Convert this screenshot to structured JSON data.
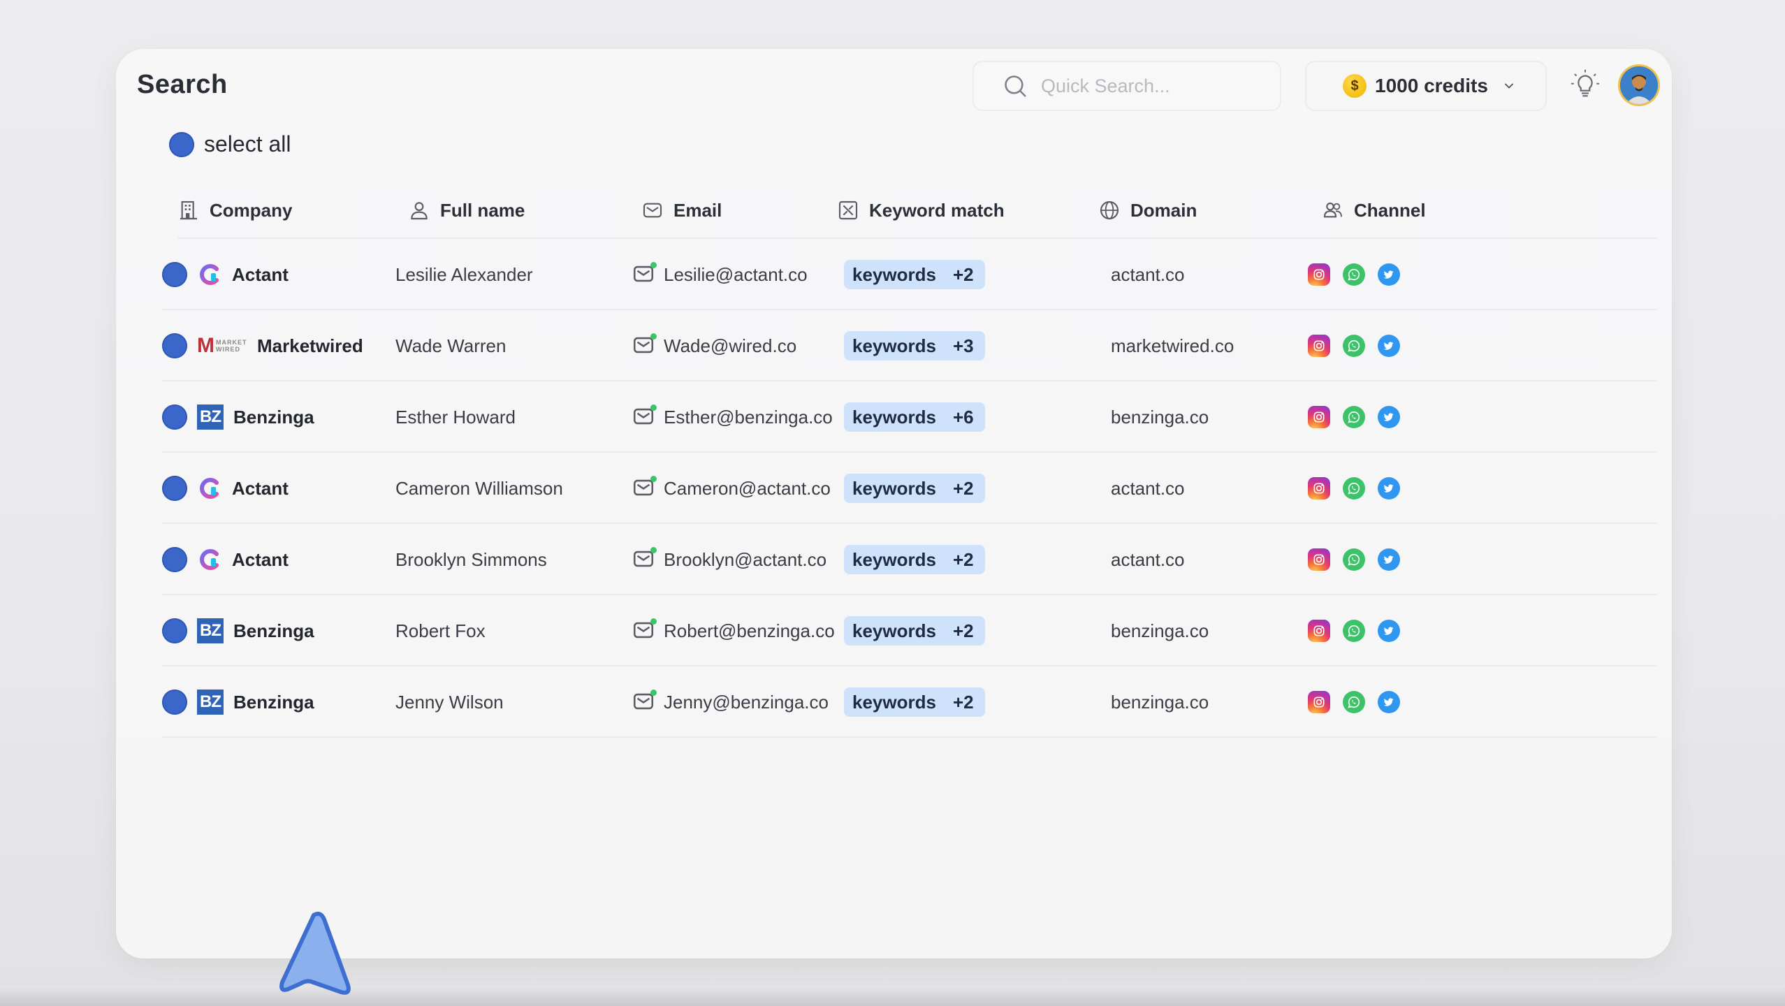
{
  "header": {
    "title": "Search",
    "search_placeholder": "Quick Search...",
    "credits_label": "1000 credits",
    "coin_symbol": "$"
  },
  "select_all_label": "select all",
  "columns": [
    {
      "label": "Company",
      "icon": "building-icon"
    },
    {
      "label": "Full name",
      "icon": "user-icon"
    },
    {
      "label": "Email",
      "icon": "mail-icon"
    },
    {
      "label": "Keyword match",
      "icon": "keyword-icon"
    },
    {
      "label": "Domain",
      "icon": "globe-icon"
    },
    {
      "label": "Channel",
      "icon": "users-icon"
    }
  ],
  "rows": [
    {
      "company": "Actant",
      "logo": "actant",
      "name": "Lesilie Alexander",
      "email": "Lesilie@actant.co",
      "keywords": "keywords",
      "extra": "+2",
      "domain": "actant.co"
    },
    {
      "company": "Marketwired",
      "logo": "marketwired",
      "name": "Wade Warren",
      "email": "Wade@wired.co",
      "keywords": "keywords",
      "extra": "+3",
      "domain": "marketwired.co"
    },
    {
      "company": "Benzinga",
      "logo": "benzinga",
      "name": "Esther Howard",
      "email": "Esther@benzinga.co",
      "keywords": "keywords",
      "extra": "+6",
      "domain": "benzinga.co"
    },
    {
      "company": "Actant",
      "logo": "actant",
      "name": "Cameron Williamson",
      "email": "Cameron@actant.co",
      "keywords": "keywords",
      "extra": "+2",
      "domain": "actant.co"
    },
    {
      "company": "Actant",
      "logo": "actant",
      "name": "Brooklyn Simmons",
      "email": "Brooklyn@actant.co",
      "keywords": "keywords",
      "extra": "+2",
      "domain": "actant.co"
    },
    {
      "company": "Benzinga",
      "logo": "benzinga",
      "name": "Robert Fox",
      "email": "Robert@benzinga.co",
      "keywords": "keywords",
      "extra": "+2",
      "domain": "benzinga.co"
    },
    {
      "company": "Benzinga",
      "logo": "benzinga",
      "name": "Jenny Wilson",
      "email": "Jenny@benzinga.co",
      "keywords": "keywords",
      "extra": "+2",
      "domain": "benzinga.co"
    }
  ],
  "logo_text": {
    "benzinga": "BZ",
    "marketwired_mark": "M",
    "marketwired_small": "MARKET WIRED"
  },
  "channels": [
    "instagram-icon",
    "whatsapp-icon",
    "twitter-icon"
  ],
  "colors": {
    "accent_blue": "#3a67c9",
    "keyword_badge": "#cfe2fb",
    "instagram": "#e23a6f",
    "whatsapp": "#3cc36a",
    "twitter": "#2f97f0",
    "coin": "#f0b400"
  }
}
